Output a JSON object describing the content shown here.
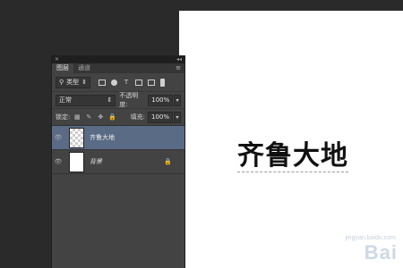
{
  "canvas": {
    "text": "齐鲁大地"
  },
  "watermark": {
    "brand": "Bai",
    "url": "jingyan.baidu.com"
  },
  "panel": {
    "close_glyph": "✕",
    "collapse_glyph": "◂◂",
    "tabs": [
      {
        "label": "图层",
        "active": true
      },
      {
        "label": "通道",
        "active": false
      }
    ],
    "menu_glyph": "≡",
    "filter": {
      "search_glyph": "⚲",
      "value": "类型",
      "arrow": "⇕",
      "icons": [
        "image-filter-icon",
        "adjustment-filter-icon",
        "type-filter-icon",
        "shape-filter-icon",
        "smart-object-filter-icon"
      ]
    },
    "blend": {
      "mode": "正常",
      "arrow": "⇕",
      "opacity_label": "不透明度:",
      "opacity_value": "100%",
      "dd": "▾"
    },
    "lock": {
      "label": "锁定:",
      "fill_label": "填充:",
      "fill_value": "100%",
      "dd": "▾"
    },
    "layers": [
      {
        "name": "齐鲁大地",
        "selected": true,
        "eye": "👁",
        "transparent": true,
        "locked": false,
        "italic": false
      },
      {
        "name": "背景",
        "selected": false,
        "eye": "👁",
        "transparent": false,
        "locked": true,
        "italic": true
      }
    ],
    "lock_glyph": "🔒"
  },
  "colors": {
    "selected_layer": "#5a6b85",
    "panel_bg": "#434343",
    "workspace_bg": "#2a2a2a"
  }
}
